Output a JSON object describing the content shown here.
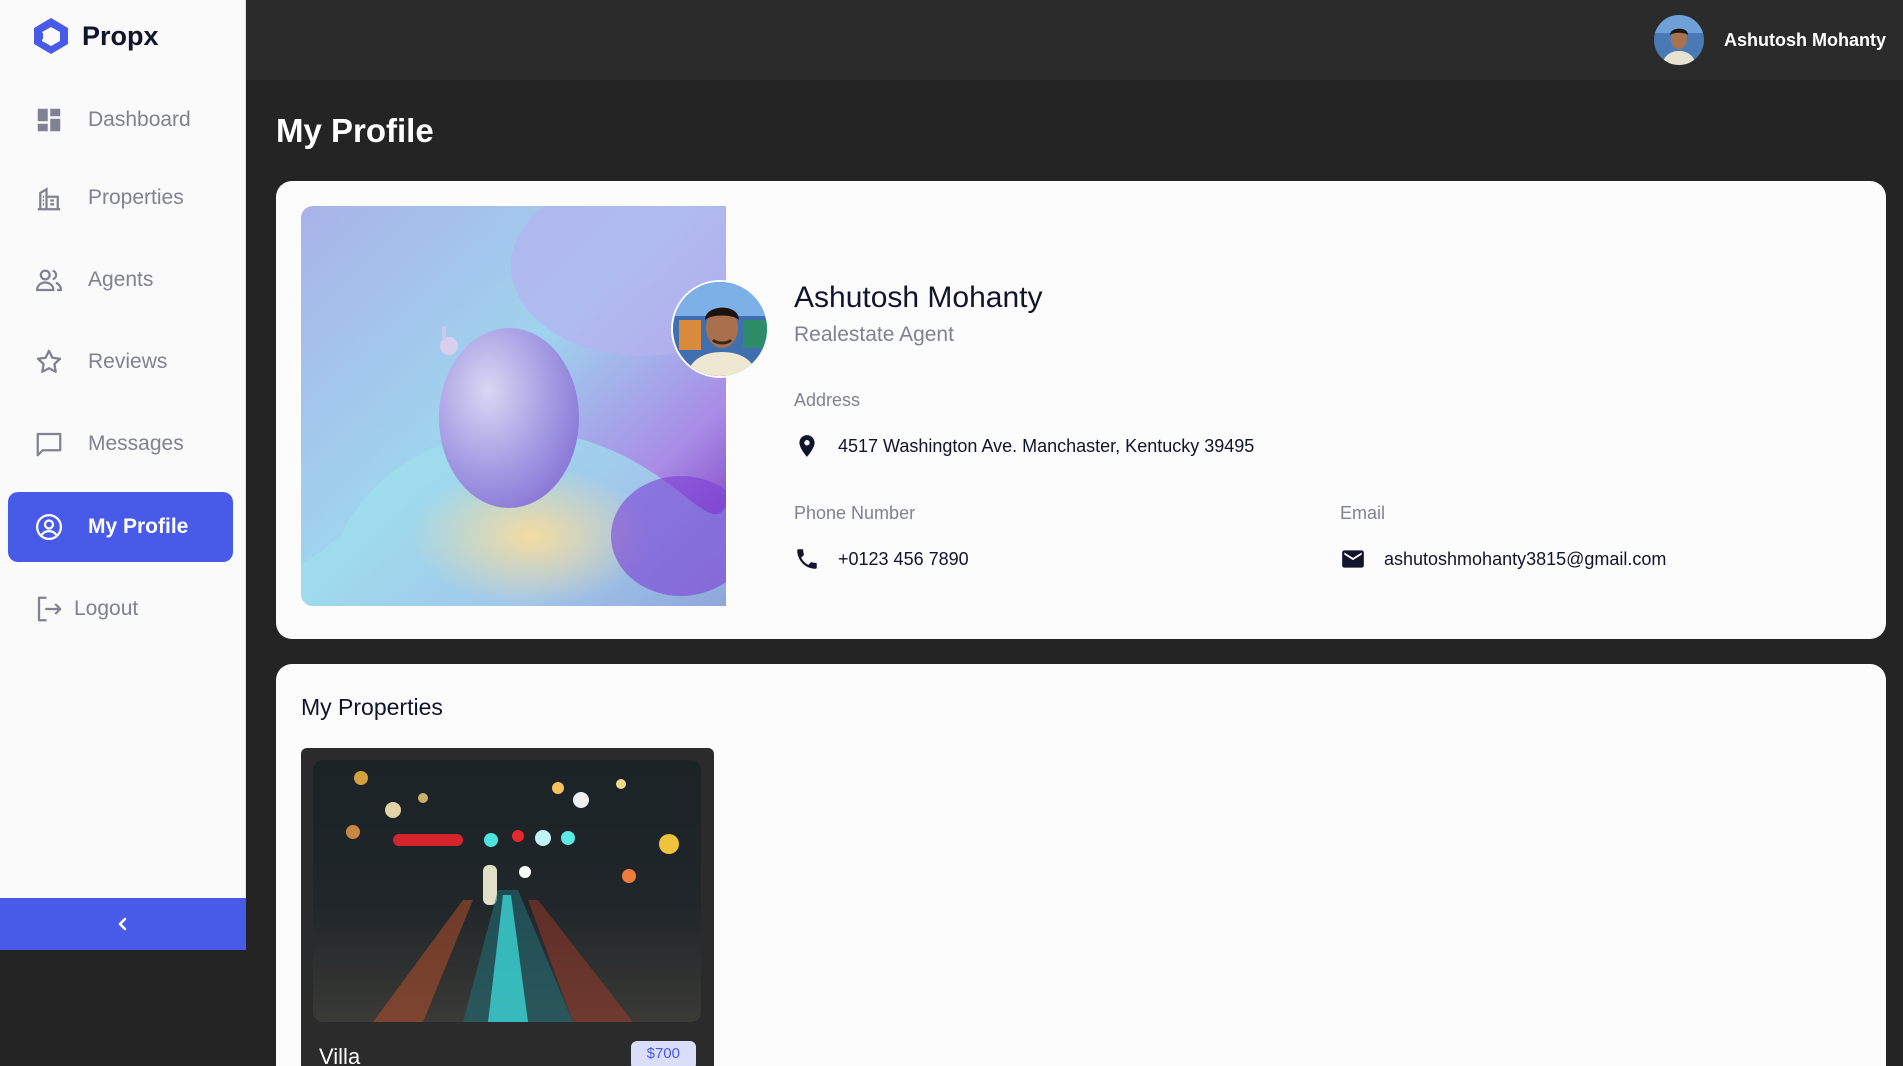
{
  "brand": {
    "name": "Propx",
    "logo_icon": "propx-logo-icon",
    "accent": "#475be8"
  },
  "sidebar": {
    "items": [
      {
        "label": "Dashboard",
        "icon": "dashboard-icon"
      },
      {
        "label": "Properties",
        "icon": "properties-icon"
      },
      {
        "label": "Agents",
        "icon": "agents-icon"
      },
      {
        "label": "Reviews",
        "icon": "star-icon"
      },
      {
        "label": "Messages",
        "icon": "message-icon"
      },
      {
        "label": "My Profile",
        "icon": "profile-icon",
        "active": true
      },
      {
        "label": "Logout",
        "icon": "logout-icon"
      }
    ],
    "collapse_icon": "chevron-left-icon"
  },
  "header": {
    "user_name": "Ashutosh Mohanty"
  },
  "page": {
    "title": "My Profile"
  },
  "profile": {
    "name": "Ashutosh Mohanty",
    "role": "Realestate Agent",
    "address_label": "Address",
    "address": "4517 Washington Ave. Manchaster, Kentucky 39495",
    "phone_label": "Phone Number",
    "phone": "+0123 456 7890",
    "email_label": "Email",
    "email": "ashutoshmohanty3815@gmail.com"
  },
  "properties": {
    "title": "My Properties",
    "items": [
      {
        "name": "Villa",
        "price": "$700"
      }
    ]
  }
}
